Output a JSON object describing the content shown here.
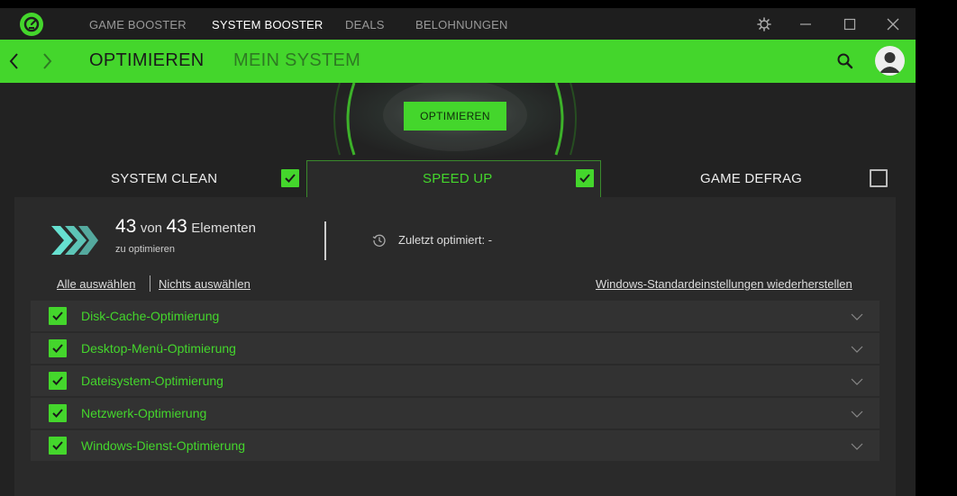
{
  "titlebar": {
    "nav": [
      "GAME BOOSTER",
      "SYSTEM BOOSTER",
      "DEALS",
      "BELOHNUNGEN"
    ],
    "active_index": 1
  },
  "greenbar": {
    "tabs": [
      "OPTIMIEREN",
      "MEIN SYSTEM"
    ]
  },
  "hero": {
    "button_label": "OPTIMIEREN"
  },
  "sections": [
    {
      "label": "SYSTEM CLEAN",
      "checked": true
    },
    {
      "label": "SPEED UP",
      "checked": true
    },
    {
      "label": "GAME DEFRAG",
      "checked": false
    }
  ],
  "summary": {
    "count": "43",
    "of_word": "von",
    "total": "43",
    "unit": "Elementen",
    "subtitle": "zu optimieren",
    "last_label": "Zuletzt optimiert:",
    "last_value": "-"
  },
  "links": {
    "select_all": "Alle auswählen",
    "select_none": "Nichts auswählen",
    "restore": "Windows-Standardeinstellungen wiederherstellen"
  },
  "items": [
    {
      "label": "Disk-Cache-Optimierung",
      "checked": true
    },
    {
      "label": "Desktop-Menü-Optimierung",
      "checked": true
    },
    {
      "label": "Dateisystem-Optimierung",
      "checked": true
    },
    {
      "label": "Netzwerk-Optimierung",
      "checked": true
    },
    {
      "label": "Windows-Dienst-Optimierung",
      "checked": true
    }
  ],
  "colors": {
    "accent": "#44d62c",
    "background": "#222222",
    "panel": "#2a2a2a"
  },
  "icons": [
    "app-logo-icon",
    "settings-icon",
    "minimize-icon",
    "maximize-icon",
    "close-icon",
    "back-arrow-icon",
    "forward-arrow-icon",
    "search-icon",
    "user-avatar-icon",
    "chevrons-right-icon",
    "history-clock-icon",
    "chevron-down-icon",
    "checkmark-icon"
  ]
}
